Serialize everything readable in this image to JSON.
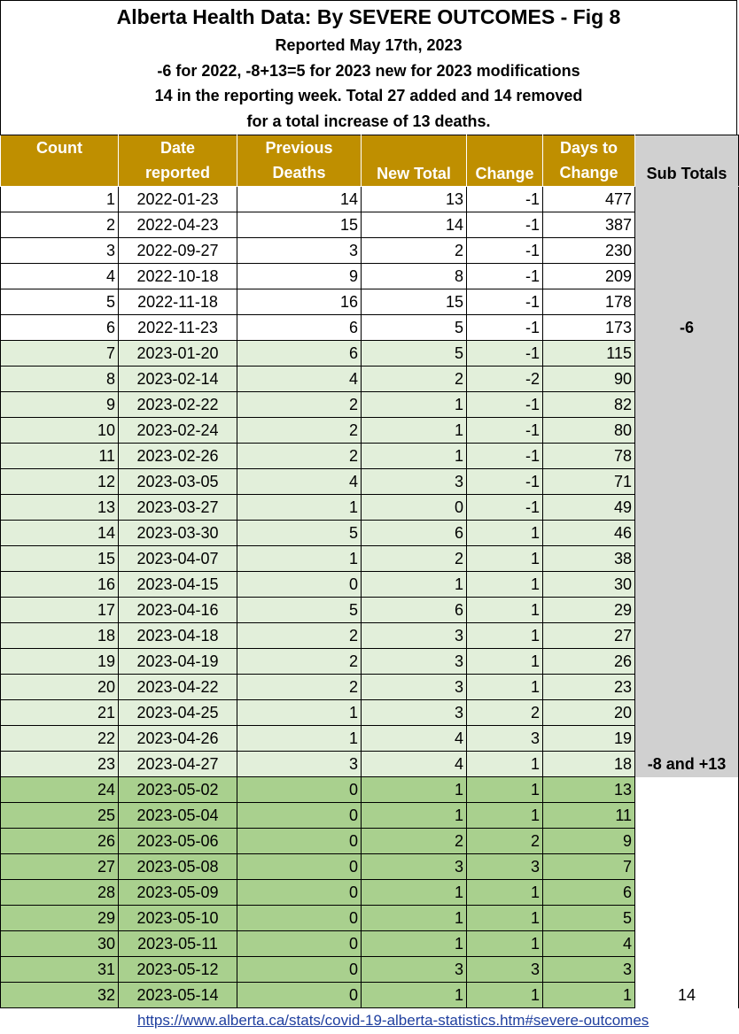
{
  "title": {
    "line1": "Alberta Health Data: By SEVERE OUTCOMES - Fig 8",
    "line2": "Reported May 17th, 2023",
    "line3": "-6 for 2022, -8+13=5 for 2023 new for 2023 modifications",
    "line4": "14 in the reporting week. Total 27 added and 14 removed",
    "line5": "for a total increase of 13 deaths."
  },
  "headers": {
    "count": "Count",
    "date_1": "Date",
    "date_2": "reported",
    "prev_1": "Previous",
    "prev_2": "Deaths",
    "new_total": "New Total",
    "change": "Change",
    "days_1": "Days to",
    "days_2": "Change",
    "sub_totals": "Sub Totals"
  },
  "rows": [
    {
      "count": "1",
      "date": "2022-01-23",
      "prev": "14",
      "new": "13",
      "change": "-1",
      "days": "477"
    },
    {
      "count": "2",
      "date": "2022-04-23",
      "prev": "15",
      "new": "14",
      "change": "-1",
      "days": "387"
    },
    {
      "count": "3",
      "date": "2022-09-27",
      "prev": "3",
      "new": "2",
      "change": "-1",
      "days": "230"
    },
    {
      "count": "4",
      "date": "2022-10-18",
      "prev": "9",
      "new": "8",
      "change": "-1",
      "days": "209"
    },
    {
      "count": "5",
      "date": "2022-11-18",
      "prev": "16",
      "new": "15",
      "change": "-1",
      "days": "178"
    },
    {
      "count": "6",
      "date": "2022-11-23",
      "prev": "6",
      "new": "5",
      "change": "-1",
      "days": "173"
    },
    {
      "count": "7",
      "date": "2023-01-20",
      "prev": "6",
      "new": "5",
      "change": "-1",
      "days": "115"
    },
    {
      "count": "8",
      "date": "2023-02-14",
      "prev": "4",
      "new": "2",
      "change": "-2",
      "days": "90"
    },
    {
      "count": "9",
      "date": "2023-02-22",
      "prev": "2",
      "new": "1",
      "change": "-1",
      "days": "82"
    },
    {
      "count": "10",
      "date": "2023-02-24",
      "prev": "2",
      "new": "1",
      "change": "-1",
      "days": "80"
    },
    {
      "count": "11",
      "date": "2023-02-26",
      "prev": "2",
      "new": "1",
      "change": "-1",
      "days": "78"
    },
    {
      "count": "12",
      "date": "2023-03-05",
      "prev": "4",
      "new": "3",
      "change": "-1",
      "days": "71"
    },
    {
      "count": "13",
      "date": "2023-03-27",
      "prev": "1",
      "new": "0",
      "change": "-1",
      "days": "49"
    },
    {
      "count": "14",
      "date": "2023-03-30",
      "prev": "5",
      "new": "6",
      "change": "1",
      "days": "46"
    },
    {
      "count": "15",
      "date": "2023-04-07",
      "prev": "1",
      "new": "2",
      "change": "1",
      "days": "38"
    },
    {
      "count": "16",
      "date": "2023-04-15",
      "prev": "0",
      "new": "1",
      "change": "1",
      "days": "30"
    },
    {
      "count": "17",
      "date": "2023-04-16",
      "prev": "5",
      "new": "6",
      "change": "1",
      "days": "29"
    },
    {
      "count": "18",
      "date": "2023-04-18",
      "prev": "2",
      "new": "3",
      "change": "1",
      "days": "27"
    },
    {
      "count": "19",
      "date": "2023-04-19",
      "prev": "2",
      "new": "3",
      "change": "1",
      "days": "26"
    },
    {
      "count": "20",
      "date": "2023-04-22",
      "prev": "2",
      "new": "3",
      "change": "1",
      "days": "23"
    },
    {
      "count": "21",
      "date": "2023-04-25",
      "prev": "1",
      "new": "3",
      "change": "2",
      "days": "20"
    },
    {
      "count": "22",
      "date": "2023-04-26",
      "prev": "1",
      "new": "4",
      "change": "3",
      "days": "19"
    },
    {
      "count": "23",
      "date": "2023-04-27",
      "prev": "3",
      "new": "4",
      "change": "1",
      "days": "18"
    },
    {
      "count": "24",
      "date": "2023-05-02",
      "prev": "0",
      "new": "1",
      "change": "1",
      "days": "13"
    },
    {
      "count": "25",
      "date": "2023-05-04",
      "prev": "0",
      "new": "1",
      "change": "1",
      "days": "11"
    },
    {
      "count": "26",
      "date": "2023-05-06",
      "prev": "0",
      "new": "2",
      "change": "2",
      "days": "9"
    },
    {
      "count": "27",
      "date": "2023-05-08",
      "prev": "0",
      "new": "3",
      "change": "3",
      "days": "7"
    },
    {
      "count": "28",
      "date": "2023-05-09",
      "prev": "0",
      "new": "1",
      "change": "1",
      "days": "6"
    },
    {
      "count": "29",
      "date": "2023-05-10",
      "prev": "0",
      "new": "1",
      "change": "1",
      "days": "5"
    },
    {
      "count": "30",
      "date": "2023-05-11",
      "prev": "0",
      "new": "1",
      "change": "1",
      "days": "4"
    },
    {
      "count": "31",
      "date": "2023-05-12",
      "prev": "0",
      "new": "3",
      "change": "3",
      "days": "3"
    },
    {
      "count": "32",
      "date": "2023-05-14",
      "prev": "0",
      "new": "1",
      "change": "1",
      "days": "1"
    }
  ],
  "sub_totals": {
    "group_2022": "-6",
    "group_2023": "-8 and +13",
    "group_week": "14"
  },
  "footer": {
    "link_text": "https://www.alberta.ca/stats/covid-19-alberta-statistics.htm#severe-outcomes"
  },
  "colors": {
    "header_gold": "#bf8f00",
    "row_2022": "#ffffff",
    "row_2023": "#e2efda",
    "row_week": "#a9d08e",
    "subtotal_grey": "#d0d0d0",
    "link_blue": "#1f3f9f"
  }
}
